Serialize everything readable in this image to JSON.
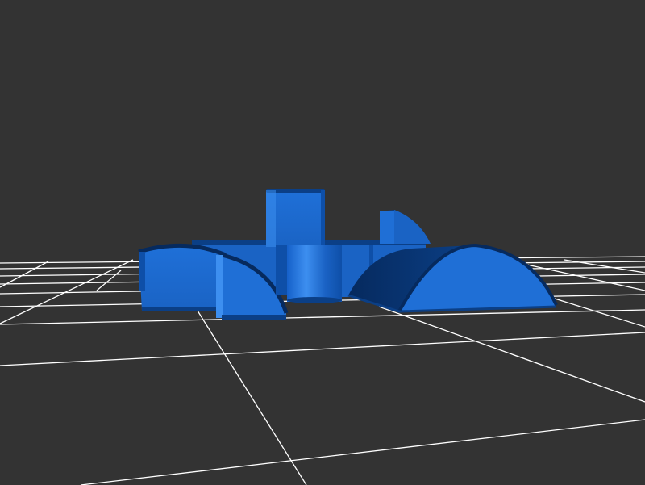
{
  "scene": {
    "background_color": "#333333",
    "grid_color": "#ffffff",
    "model_color": "#1f6fd6",
    "model_shade_dark": "#0b3f86",
    "model_shade_deep": "#062a5e",
    "model_highlight": "#3d8ff0"
  }
}
